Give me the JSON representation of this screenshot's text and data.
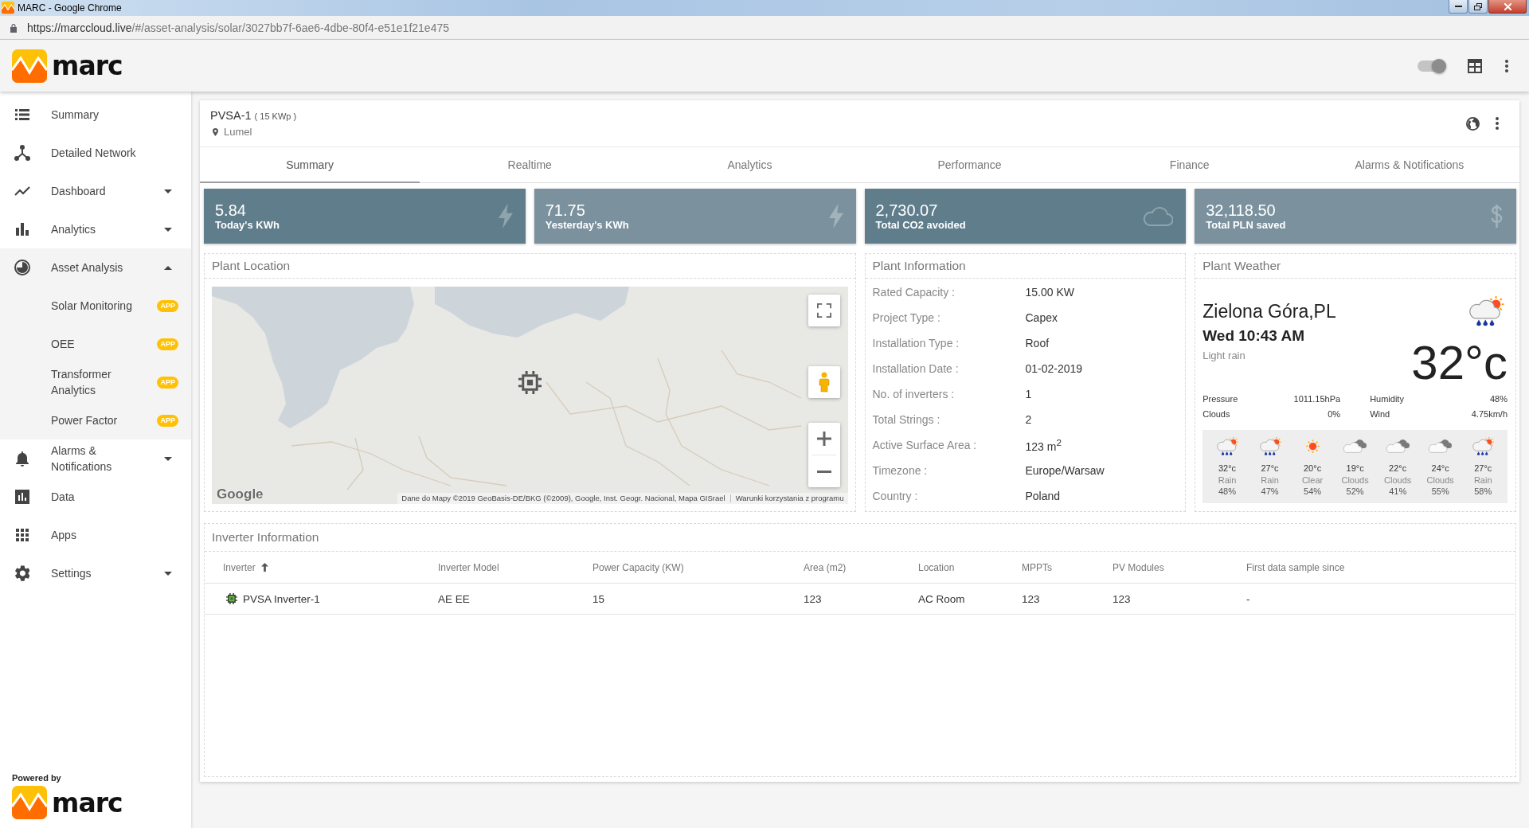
{
  "browser": {
    "title": "MARC - Google Chrome",
    "url_origin": "https://marccloud.live",
    "url_path": "/#/asset-analysis/solar/3027bb7f-6ae6-4dbe-80f4-e51e1f21e475"
  },
  "header": {
    "logo": "marc",
    "toggle": {
      "on": true
    }
  },
  "sidebar": {
    "items": [
      {
        "label": "Summary",
        "kind": "link"
      },
      {
        "label": "Detailed Network",
        "kind": "link"
      },
      {
        "label": "Dashboard",
        "kind": "group",
        "expanded": false
      },
      {
        "label": "Analytics",
        "kind": "group",
        "expanded": false
      },
      {
        "label": "Asset Analysis",
        "kind": "group",
        "expanded": true,
        "children": [
          {
            "label": "Solar Monitoring",
            "badge": "APP"
          },
          {
            "label": "OEE",
            "badge": "APP"
          },
          {
            "label": "Transformer Analytics",
            "badge": "APP"
          },
          {
            "label": "Power Factor",
            "badge": "APP"
          }
        ]
      },
      {
        "label": "Alarms & Notifications",
        "kind": "group",
        "expanded": false
      },
      {
        "label": "Data",
        "kind": "link"
      },
      {
        "label": "Apps",
        "kind": "link"
      },
      {
        "label": "Settings",
        "kind": "group",
        "expanded": false
      }
    ],
    "footer": {
      "caption": "Powered by",
      "logo": "marc"
    }
  },
  "asset": {
    "name": "PVSA-1",
    "capacity": "( 15 KWp )",
    "location": "Lumel"
  },
  "tabs": [
    {
      "label": "Summary",
      "selected": true
    },
    {
      "label": "Realtime",
      "selected": false
    },
    {
      "label": "Analytics",
      "selected": false
    },
    {
      "label": "Performance",
      "selected": false
    },
    {
      "label": "Finance",
      "selected": false
    },
    {
      "label": "Alarms & Notifications",
      "selected": false
    }
  ],
  "kpis": [
    {
      "value": "5.84",
      "label": "Today's KWh",
      "kind": "energy"
    },
    {
      "value": "71.75",
      "label": "Yesterday's KWh",
      "kind": "energy"
    },
    {
      "value": "2,730.07",
      "label": "Total CO2 avoided",
      "kind": "emission"
    },
    {
      "value": "32,118.50",
      "label": "Total PLN saved",
      "kind": "money"
    }
  ],
  "plant_location": {
    "title": "Plant Location",
    "map": {
      "logo": "Google",
      "attribution": "Dane do Mapy ©2019 GeoBasis-DE/BKG (©2009), Google, Inst. Geogr. Nacional, Mapa GISrael",
      "terms": "Warunki korzystania z programu"
    }
  },
  "plant_information": {
    "title": "Plant Information",
    "rows": [
      {
        "label": "Rated Capacity :",
        "value": "15.00 KW"
      },
      {
        "label": "Project Type :",
        "value": "Capex"
      },
      {
        "label": "Installation Type :",
        "value": "Roof"
      },
      {
        "label": "Installation Date :",
        "value": "01-02-2019"
      },
      {
        "label": "No. of inverters :",
        "value": "1"
      },
      {
        "label": "Total Strings :",
        "value": "2"
      },
      {
        "label": "Active Surface Area :",
        "value": "123 m$^{2}$"
      },
      {
        "label": "Timezone :",
        "value": "Europe/Warsaw"
      },
      {
        "label": "Country :",
        "value": "Poland"
      }
    ]
  },
  "plant_weather": {
    "title": "Plant Weather",
    "city": "Zielona Góra,PL",
    "time": "Wed 10:43 AM",
    "condition": "Light rain",
    "kind": "rain",
    "temperature": "32°c",
    "stats": [
      {
        "label": "Pressure",
        "value": "1011.15hPa"
      },
      {
        "label": "Humidity",
        "value": "48%"
      },
      {
        "label": "Clouds",
        "value": "0%"
      },
      {
        "label": "Wind",
        "value": "4.75km/h"
      }
    ],
    "forecast": [
      {
        "kind": "rain",
        "temp": "32°c",
        "condition": "Rain",
        "humidity": "48%"
      },
      {
        "kind": "rain",
        "temp": "27°c",
        "condition": "Rain",
        "humidity": "47%"
      },
      {
        "kind": "clear",
        "temp": "20°c",
        "condition": "Clear",
        "humidity": "54%"
      },
      {
        "kind": "clouds",
        "temp": "19°c",
        "condition": "Clouds",
        "humidity": "52%"
      },
      {
        "kind": "clouds",
        "temp": "22°c",
        "condition": "Clouds",
        "humidity": "41%"
      },
      {
        "kind": "clouds",
        "temp": "24°c",
        "condition": "Clouds",
        "humidity": "55%"
      },
      {
        "kind": "rain",
        "temp": "27°c",
        "condition": "Rain",
        "humidity": "58%"
      }
    ]
  },
  "inverters": {
    "title": "Inverter Information",
    "columns": [
      {
        "label": "Inverter",
        "sorted": true
      },
      {
        "label": "Inverter Model",
        "sorted": false
      },
      {
        "label": "Power Capacity (KW)",
        "sorted": false
      },
      {
        "label": "Area (m2)",
        "sorted": false
      },
      {
        "label": "Location",
        "sorted": false
      },
      {
        "label": "MPPTs",
        "sorted": false
      },
      {
        "label": "PV Modules",
        "sorted": false
      },
      {
        "label": "First data sample since",
        "sorted": false
      }
    ],
    "rows": [
      {
        "cells": [
          "PVSA Inverter-1",
          "AE EE",
          "15",
          "123",
          "AC Room",
          "123",
          "123",
          "-"
        ]
      }
    ]
  }
}
